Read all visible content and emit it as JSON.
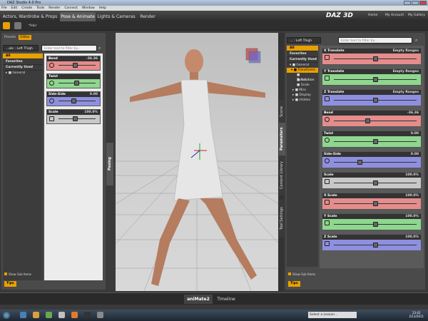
{
  "window": {
    "title": "DAZ Studio 4.0 Pro"
  },
  "menu": [
    "File",
    "Edit",
    "Create",
    "Tools",
    "Render",
    "Connect",
    "Window",
    "Help"
  ],
  "main_tabs": [
    {
      "label": "Actors, Wardrobe & Props"
    },
    {
      "label": "Pose & Animate"
    },
    {
      "label": "Lights & Cameras"
    },
    {
      "label": "Render"
    }
  ],
  "brand": {
    "logo": "DAZ 3D"
  },
  "top_links": [
    "Home",
    "My Account",
    "My Gallery"
  ],
  "toolbar": {
    "tool_label": "*Hair"
  },
  "left_pane": {
    "tabs": [
      "Presets",
      "Editor"
    ],
    "node": "...ale : Left Thigh",
    "filter_placeholder": "Enter text to filter by...",
    "categories": [
      "All",
      "Favorites",
      "Currently Used"
    ],
    "tree": [
      "General"
    ],
    "params": [
      {
        "name": "Bend",
        "value": "-36.36",
        "color": "red",
        "knob": 0.45
      },
      {
        "name": "Twist",
        "value": "",
        "color": "green",
        "knob": 0.48
      },
      {
        "name": "Side-Side",
        "value": "0.00",
        "color": "blue",
        "knob": 0.4
      },
      {
        "name": "Scale",
        "value": "100.0%",
        "color": "grey",
        "knob": 0.45
      }
    ],
    "show_sub_items": "Show Sub Items",
    "tips": "Tips",
    "side_tab": "Posing"
  },
  "right_pane": {
    "node": "... : Left Thigh",
    "filter_placeholder": "Enter text to filter by...",
    "categories": [
      "All",
      "Favorites",
      "Currently Used"
    ],
    "tree": [
      "General",
      "Transforms",
      "Translation",
      "Rotation",
      "Scale",
      "Misc",
      "Display",
      "Hidden"
    ],
    "params": [
      {
        "name": "X Translate",
        "value": "Empty Ranges",
        "color": "red",
        "knob": 0.5
      },
      {
        "name": "Y Translate",
        "value": "Empty Ranges",
        "color": "green",
        "knob": 0.5
      },
      {
        "name": "Z Translate",
        "value": "Empty Ranges",
        "color": "blue",
        "knob": 0.5
      },
      {
        "name": "Bend",
        "value": "-36.36",
        "color": "red",
        "knob": 0.4
      },
      {
        "name": "Twist",
        "value": "0.00",
        "color": "green",
        "knob": 0.5
      },
      {
        "name": "Side-Side",
        "value": "0.00",
        "color": "blue",
        "knob": 0.3
      },
      {
        "name": "Scale",
        "value": "100.0%",
        "color": "grey",
        "knob": 0.5
      },
      {
        "name": "X Scale",
        "value": "100.0%",
        "color": "red",
        "knob": 0.5
      },
      {
        "name": "Y Scale",
        "value": "100.0%",
        "color": "green",
        "knob": 0.5
      },
      {
        "name": "Z Scale",
        "value": "100.0%",
        "color": "blue",
        "knob": 0.5
      }
    ],
    "side_tabs": [
      "Scene",
      "Parameters",
      "Content Library",
      "Tool Settings"
    ],
    "show_sub_items": "Show Sub Items",
    "tips": "Tips"
  },
  "bottom_tabs": [
    "aniMate2",
    "Timeline"
  ],
  "taskbar": {
    "lesson": "Select a Lesson...",
    "time": "23:42",
    "date": "2/13/2011"
  }
}
